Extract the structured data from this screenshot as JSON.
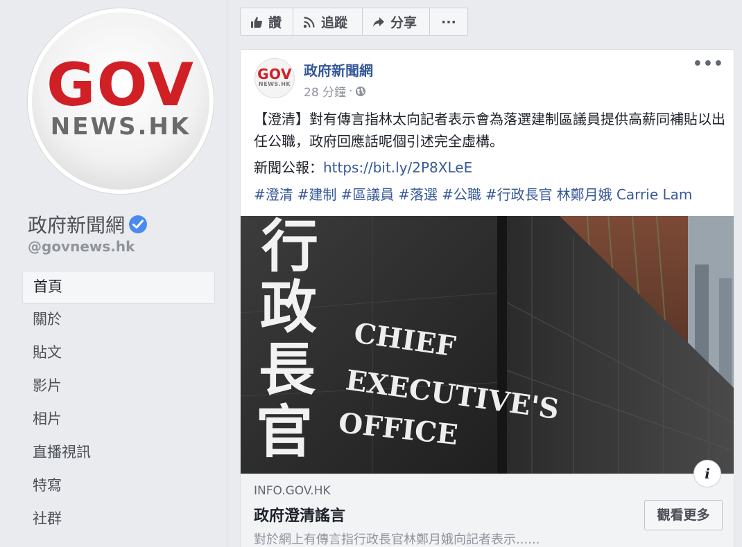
{
  "page": {
    "logo": {
      "top": "GOV",
      "bottom": "NEWS.HK"
    },
    "name": "政府新聞網",
    "handle": "@govnews.hk",
    "verified": true
  },
  "nav": [
    {
      "label": "首頁",
      "active": true
    },
    {
      "label": "關於"
    },
    {
      "label": "貼文"
    },
    {
      "label": "影片"
    },
    {
      "label": "相片"
    },
    {
      "label": "直播視訊"
    },
    {
      "label": "特寫"
    },
    {
      "label": "社群"
    }
  ],
  "toolbar": {
    "like_label": "讚",
    "follow_label": "追蹤",
    "share_label": "分享",
    "more_label": "···"
  },
  "post": {
    "avatar_logo": {
      "top": "GOV",
      "bottom": "NEWS.HK"
    },
    "author": "政府新聞網",
    "time": "28 分鐘",
    "more_label": "•••",
    "text": "【澄清】對有傳言指林太向記者表示會為落選建制區議員提供高薪同補貼以出任公職，政府回應話呢個引述完全虛構。",
    "link_prefix": "新聞公報：",
    "link_url": "https://bit.ly/2P8XLeE",
    "tags": [
      "#澄清",
      "#建制",
      "#區議員",
      "#落選",
      "#公職",
      "#行政長官",
      "林鄭月娥 Carrie Lam"
    ],
    "image": {
      "chinese_sign": [
        "行",
        "政",
        "長",
        "官"
      ],
      "english_sign": [
        "CHIEF",
        "EXECUTIVE'S",
        "OFFICE"
      ]
    },
    "info_label": "i",
    "preview": {
      "domain": "INFO.GOV.HK",
      "title": "政府澄清謠言",
      "description": "對於網上有傳言指行政長官林鄭月娥向記者表示......",
      "button_label": "觀看更多"
    }
  },
  "colors": {
    "link_blue": "#365899",
    "verified_blue": "#4b8af0",
    "logo_red": "#d11f26",
    "background": "#e9ebee"
  }
}
